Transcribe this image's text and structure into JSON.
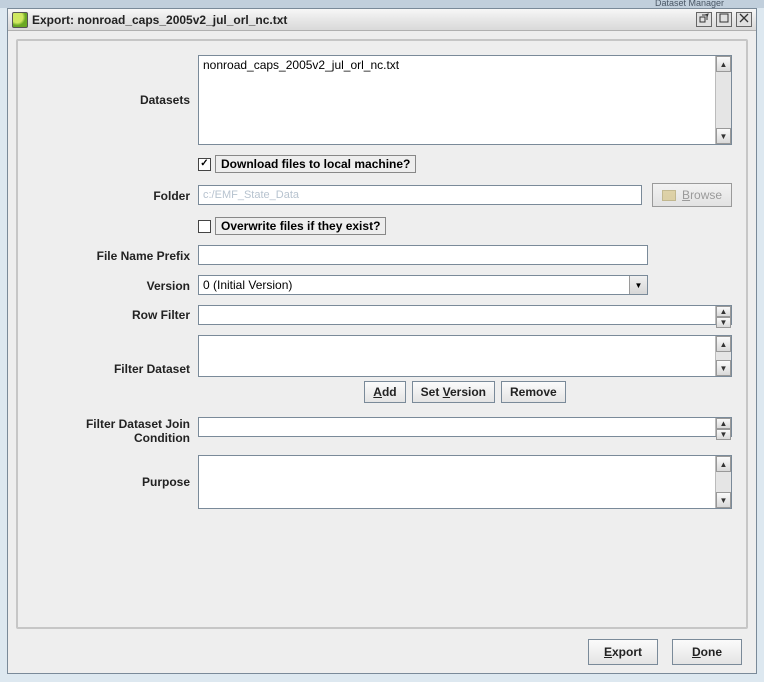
{
  "background_tab_hint": "Dataset Manager",
  "titlebar": {
    "title": "Export: nonroad_caps_2005v2_jul_orl_nc.txt"
  },
  "labels": {
    "datasets": "Datasets",
    "folder": "Folder",
    "file_name_prefix": "File Name Prefix",
    "version": "Version",
    "row_filter": "Row Filter",
    "filter_dataset": "Filter Dataset",
    "filter_join": "Filter Dataset Join Condition",
    "purpose": "Purpose"
  },
  "datasets_list": {
    "item0": "nonroad_caps_2005v2_jul_orl_nc.txt"
  },
  "download_checkbox": {
    "checked": true,
    "label": "Download files to local machine?"
  },
  "folder": {
    "value": "c:/EMF_State_Data",
    "browse_letter": "B",
    "browse_rest": "rowse"
  },
  "overwrite_checkbox": {
    "checked": false,
    "label": "Overwrite files if they exist?"
  },
  "file_name_prefix": {
    "value": ""
  },
  "version_select": {
    "value": "0 (Initial Version)"
  },
  "row_filter": {
    "value": ""
  },
  "filter_dataset": {
    "value": ""
  },
  "filter_buttons": {
    "add_u": "A",
    "add_rest": "dd",
    "setv_pre": "Set ",
    "setv_u": "V",
    "setv_rest": "ersion",
    "remove": "Remove"
  },
  "filter_join": {
    "value": ""
  },
  "purpose": {
    "value": ""
  },
  "bottom": {
    "export_u": "E",
    "export_rest": "xport",
    "done_u": "D",
    "done_rest": "one"
  }
}
